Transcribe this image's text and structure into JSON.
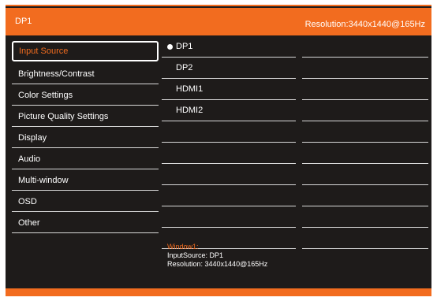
{
  "header": {
    "title": "DP1",
    "resolution": "Resolution:3440x1440@165Hz"
  },
  "menu": {
    "items": [
      {
        "label": "Input Source",
        "selected": true
      },
      {
        "label": "Brightness/Contrast"
      },
      {
        "label": "Color Settings"
      },
      {
        "label": "Picture Quality Settings"
      },
      {
        "label": "Display"
      },
      {
        "label": "Audio"
      },
      {
        "label": "Multi-window"
      },
      {
        "label": "OSD"
      },
      {
        "label": "Other"
      }
    ]
  },
  "sources": {
    "items": [
      "DP1",
      "DP2",
      "HDMI1",
      "HDMI2"
    ],
    "selected": "DP1"
  },
  "info": {
    "window_title": "Window1:",
    "input_source": "InputSource: DP1",
    "resolution": "Resolution:  3440x1440@165Hz"
  },
  "colors": {
    "accent": "#f26c1f",
    "background": "#1e1b1a",
    "text": "#ffffff"
  }
}
